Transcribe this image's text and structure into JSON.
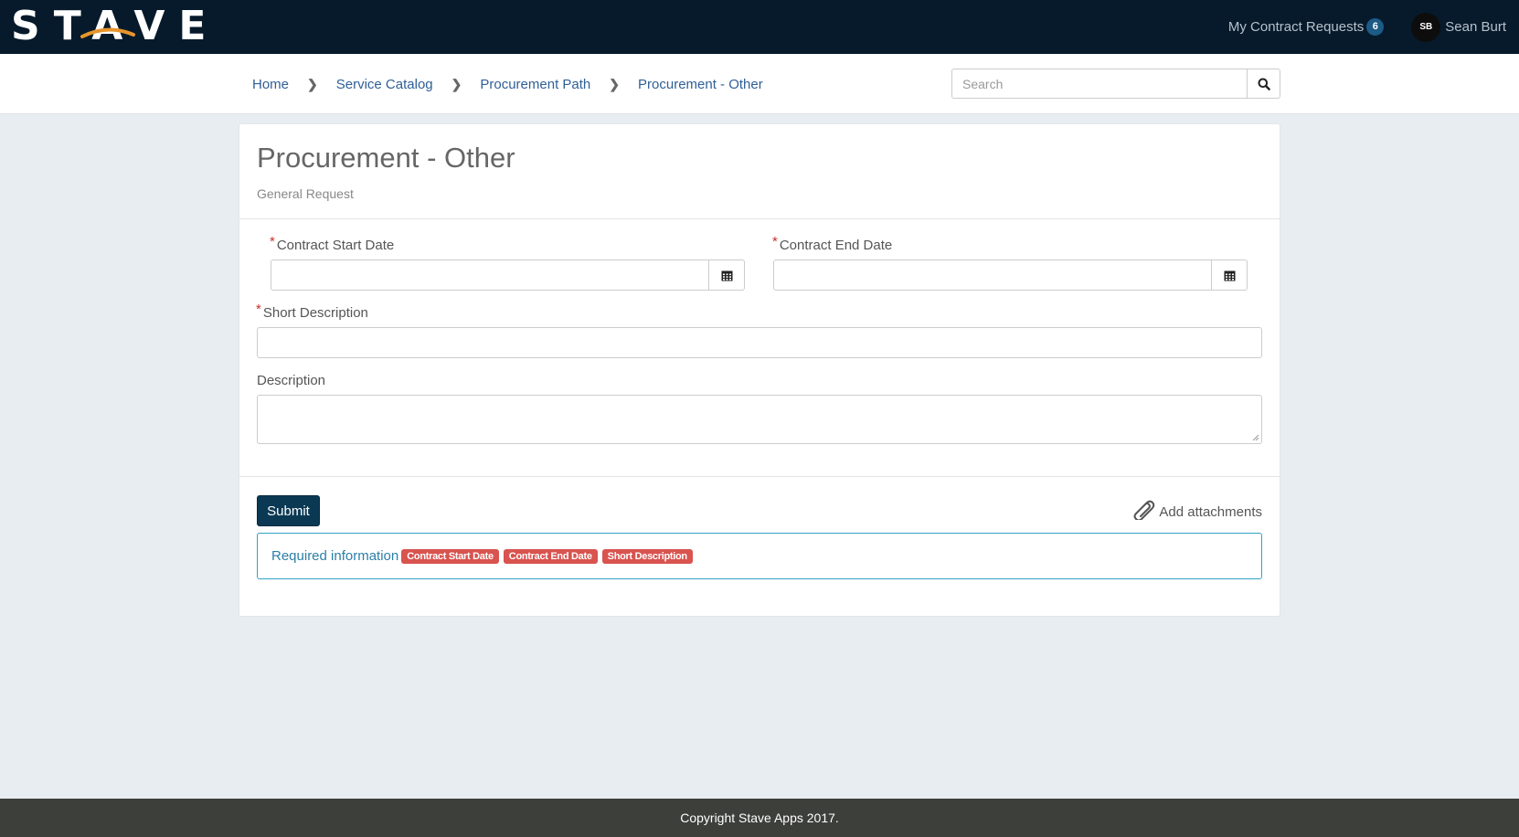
{
  "brand": {
    "logo_text": "STAVE"
  },
  "nav": {
    "my_requests_label": "My Contract Requests",
    "my_requests_count": "6",
    "user_initials": "SB",
    "user_name": "Sean Burt"
  },
  "breadcrumb": [
    "Home",
    "Service Catalog",
    "Procurement Path",
    "Procurement - Other"
  ],
  "search": {
    "placeholder": "Search",
    "value": ""
  },
  "form": {
    "title": "Procurement - Other",
    "subtitle": "General Request",
    "required_marker": "*",
    "contract_start_label": "Contract Start Date",
    "contract_end_label": "Contract End Date",
    "short_description_label": "Short Description",
    "description_label": "Description",
    "submit_label": "Submit",
    "attach_label": "Add attachments",
    "required_info_label": "Required information",
    "required_tags": [
      "Contract Start Date",
      "Contract End Date",
      "Short Description"
    ]
  },
  "footer": {
    "copyright": "Copyright Stave Apps 2017."
  },
  "colors": {
    "nav_bg": "#061a2b",
    "accent_orange": "#e8952b",
    "submit_bg": "#0b3954",
    "required_red": "#d9534f",
    "info_border": "#31a3c4",
    "footer_bg": "#3d3f3b"
  },
  "icons": {
    "search": "search-icon",
    "calendar": "calendar-icon",
    "attach": "paperclip-icon",
    "chevron": "chevron-right-icon"
  }
}
